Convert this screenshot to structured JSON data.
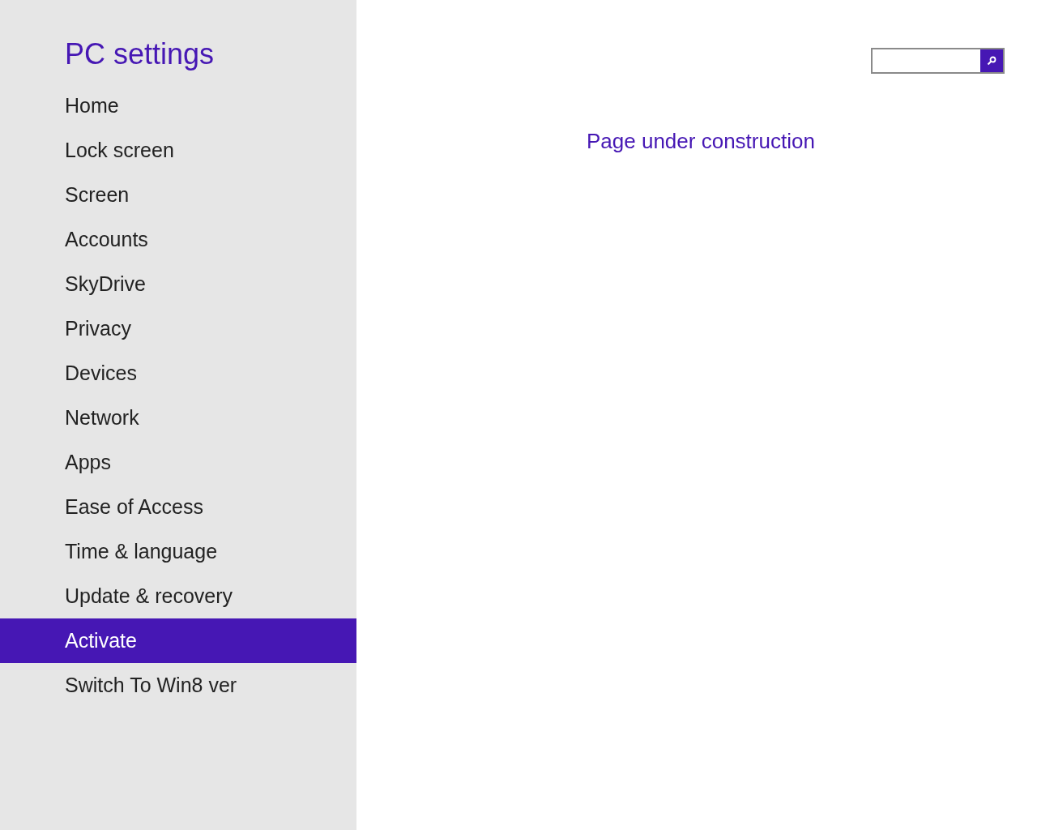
{
  "sidebar": {
    "title": "PC settings",
    "items": [
      {
        "label": "Home",
        "selected": false
      },
      {
        "label": "Lock screen",
        "selected": false
      },
      {
        "label": "Screen",
        "selected": false
      },
      {
        "label": "Accounts",
        "selected": false
      },
      {
        "label": "SkyDrive",
        "selected": false
      },
      {
        "label": "Privacy",
        "selected": false
      },
      {
        "label": "Devices",
        "selected": false
      },
      {
        "label": "Network",
        "selected": false
      },
      {
        "label": "Apps",
        "selected": false
      },
      {
        "label": "Ease of Access",
        "selected": false
      },
      {
        "label": "Time & language",
        "selected": false
      },
      {
        "label": "Update & recovery",
        "selected": false
      },
      {
        "label": "Activate",
        "selected": true
      },
      {
        "label": "Switch To Win8 ver",
        "selected": false
      }
    ]
  },
  "main": {
    "message": "Page under construction"
  }
}
